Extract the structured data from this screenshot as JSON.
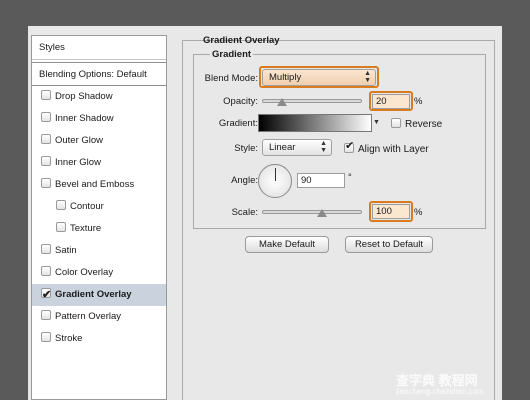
{
  "sidebar": {
    "styles_label": "Styles",
    "blending_label": "Blending Options: Default",
    "items": [
      {
        "label": "Drop Shadow",
        "checked": false,
        "sub": false,
        "selected": false
      },
      {
        "label": "Inner Shadow",
        "checked": false,
        "sub": false,
        "selected": false
      },
      {
        "label": "Outer Glow",
        "checked": false,
        "sub": false,
        "selected": false
      },
      {
        "label": "Inner Glow",
        "checked": false,
        "sub": false,
        "selected": false
      },
      {
        "label": "Bevel and Emboss",
        "checked": false,
        "sub": false,
        "selected": false
      },
      {
        "label": "Contour",
        "checked": false,
        "sub": true,
        "selected": false
      },
      {
        "label": "Texture",
        "checked": false,
        "sub": true,
        "selected": false
      },
      {
        "label": "Satin",
        "checked": false,
        "sub": false,
        "selected": false
      },
      {
        "label": "Color Overlay",
        "checked": false,
        "sub": false,
        "selected": false
      },
      {
        "label": "Gradient Overlay",
        "checked": true,
        "sub": false,
        "selected": true
      },
      {
        "label": "Pattern Overlay",
        "checked": false,
        "sub": false,
        "selected": false
      },
      {
        "label": "Stroke",
        "checked": false,
        "sub": false,
        "selected": false
      }
    ]
  },
  "panel": {
    "title": "Gradient Overlay",
    "group_title": "Gradient",
    "blend_mode_label": "Blend Mode:",
    "blend_mode_value": "Multiply",
    "opacity_label": "Opacity:",
    "opacity_value": "20",
    "opacity_level": 0.2,
    "gradient_label": "Gradient:",
    "reverse_label": "Reverse",
    "style_label": "Style:",
    "style_value": "Linear",
    "align_label": "Align with Layer",
    "angle_label": "Angle:",
    "angle_value": "90",
    "degree_symbol": "°",
    "scale_label": "Scale:",
    "scale_value": "100",
    "scale_level": 0.6,
    "percent": "%",
    "make_default": "Make Default",
    "reset_default": "Reset to Default"
  },
  "colors": {
    "highlight": "#d97c1f",
    "selected_row": "#cad2de",
    "gradient_start": "#000000",
    "gradient_end": "#ffffff"
  },
  "watermark": {
    "line1": "查字典 教程网",
    "line2": "jiaocheng.chazidian.com"
  }
}
